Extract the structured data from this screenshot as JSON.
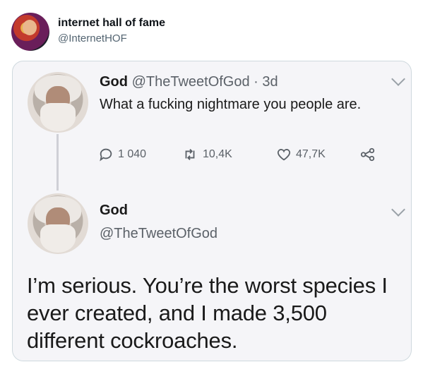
{
  "post": {
    "author_name": "internet hall of fame",
    "author_handle": "@InternetHOF"
  },
  "screenshot": {
    "tweet1": {
      "name": "God",
      "handle": "@TheTweetOfGod",
      "age": "3d",
      "text": "What a fucking nightmare you people are.",
      "replies": "1 040",
      "retweets": "10,4K",
      "likes": "47,7K",
      "icons": [
        "reply-icon",
        "retweet-icon",
        "like-icon",
        "share-icon",
        "chevron-down-icon"
      ]
    },
    "tweet2": {
      "name": "God",
      "handle": "@TheTweetOfGod",
      "text": "I’m serious. You’re the worst species I ever created, and I made 3,500 different cockroaches."
    }
  }
}
